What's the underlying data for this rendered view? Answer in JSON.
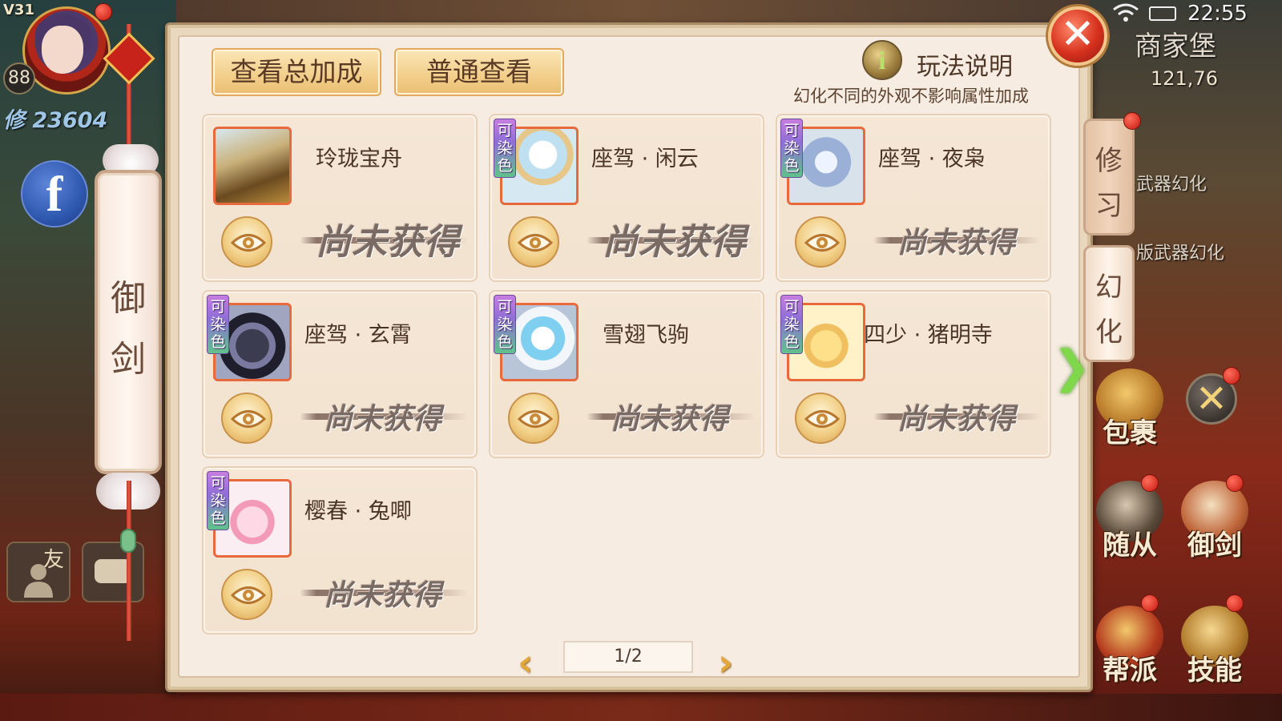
{
  "status_bar": {
    "version": "V31",
    "clock": "22:55"
  },
  "player": {
    "level": "88",
    "power": "修 23604"
  },
  "left_tab": {
    "label_1": "御",
    "label_2": "剑"
  },
  "social": {
    "friend_label": "友"
  },
  "panel": {
    "btn_total_bonus": "查看总加成",
    "btn_normal_view": "普通查看",
    "rules_label": "玩法说明",
    "rules_note": "幻化不同的外观不影响属性加成",
    "close_label": "✕"
  },
  "items": [
    {
      "name": "玲珑宝舟",
      "dyeable": false,
      "status": "尚未获得"
    },
    {
      "name": "座驾 · 闲云",
      "dyeable": true,
      "status": "尚未获得"
    },
    {
      "name": "座驾 · 夜枭",
      "dyeable": true,
      "status": "尚未获得"
    },
    {
      "name": "座驾 · 玄霄",
      "dyeable": true,
      "status": "尚未获得"
    },
    {
      "name": "雪翅飞驹",
      "dyeable": true,
      "status": "尚未获得"
    },
    {
      "name": "四少 · 猪明寺",
      "dyeable": true,
      "status": "尚未获得"
    },
    {
      "name": "樱春 · 兔唧",
      "dyeable": true,
      "status": "尚未获得"
    }
  ],
  "dye_badge": {
    "c1": "可",
    "c2": "染",
    "c3": "色"
  },
  "pagination": {
    "prev": "‹",
    "current": "1/2",
    "next": "›"
  },
  "right_hud": {
    "location": "商家堡",
    "coords": "121,76",
    "tab_xiuxi_1": "修",
    "tab_xiuxi_2": "习",
    "tab_huanhua_1": "幻",
    "tab_huanhua_2": "化",
    "bg_text_1": "武器幻化",
    "bg_text_2": "版武器幻化",
    "btn_bag": "包裹",
    "btn_follower": "随从",
    "btn_sword": "御剑",
    "btn_guild": "帮派",
    "btn_skill": "技能"
  },
  "colors": {
    "accent": "#e86a3c",
    "panel_bg": "#f6ece1",
    "button_gold": "#f2ce8a",
    "green_arrow": "#7ed84a"
  }
}
